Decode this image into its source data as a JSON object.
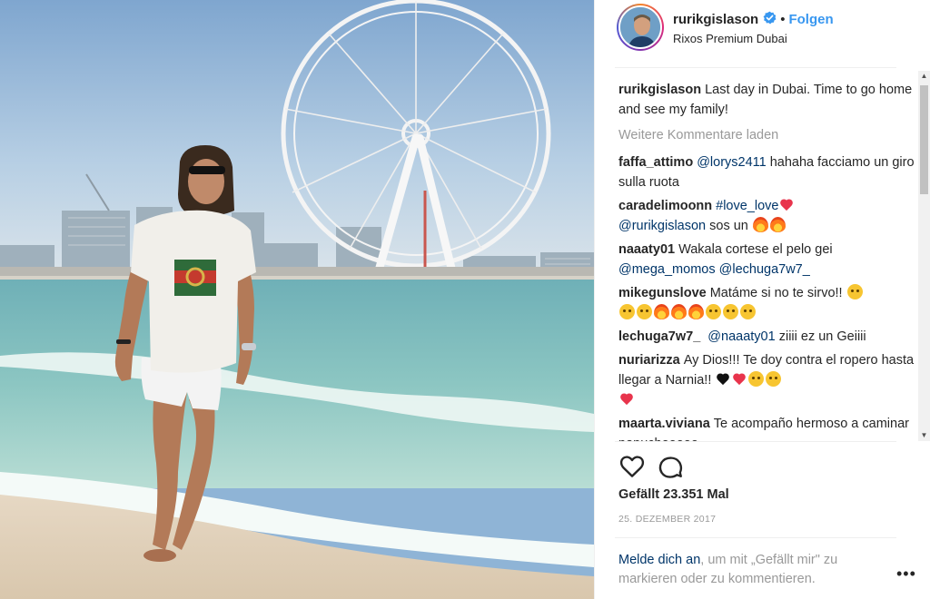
{
  "post": {
    "username": "rurikgislason",
    "separator": "•",
    "follow_label": "Folgen",
    "location": "Rixos Premium Dubai"
  },
  "caption": {
    "user": "rurikgislason",
    "text": "Last day in Dubai. Time to go home and see my family!"
  },
  "more_comments_label": "Weitere Kommentare laden",
  "comments": [
    {
      "user": "faffa_attimo",
      "mention": "@lorys2411",
      "text": " hahaha facciamo un giro sulla ruota"
    },
    {
      "user": "caradelimoonn",
      "hashtag": "#love_love",
      "mention": "@rurikgislason",
      "text": " sos un"
    },
    {
      "user": "naaaty01",
      "text": "Wakala cortese el pelo gei ",
      "mention": "@mega_momos",
      "mention2": "@lechuga7w7_"
    },
    {
      "user": "mikegunslove",
      "text": "Matáme si no te sirvo!!"
    },
    {
      "user": "lechuga7w7_",
      "mention": "@naaaty01",
      "text": " ziiii ez un Geiiii"
    },
    {
      "user": "nuriarizza",
      "text": "Ay Dios!!! Te doy contra el ropero hasta llegar a Narnia!!"
    },
    {
      "user": "maarta.viviana",
      "text": "Te acompaño hermoso a caminar papuchooooo"
    }
  ],
  "likes_label": "Gefällt 23.351 Mal",
  "date": "25. DEZEMBER 2017",
  "login": {
    "link": "Melde dich an",
    "text": ", um mit „Gefällt mir\" zu markieren oder zu kommentieren."
  },
  "more_label": "•••",
  "icons": {
    "like": "heart-outline-icon",
    "comment": "speech-bubble-icon",
    "verified": "verified-badge-icon"
  },
  "colors": {
    "link_blue": "#3897f0",
    "mention_blue": "#003569",
    "muted": "#999999",
    "text": "#262626"
  }
}
